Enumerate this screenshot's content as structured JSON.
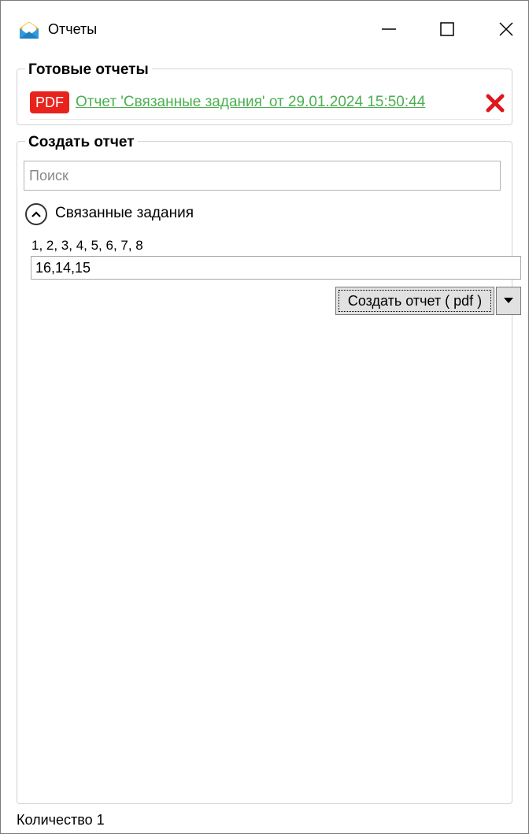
{
  "window": {
    "title": "Отчеты",
    "icons": {
      "app": "envelope-icon",
      "minimize": "minimize-icon",
      "maximize": "maximize-icon",
      "close": "close-icon"
    }
  },
  "ready_reports": {
    "title": "Готовые отчеты",
    "items": [
      {
        "badge": "PDF",
        "link_text": "Отчет 'Связанные задания' от 29.01.2024 15:50:44",
        "delete_icon": "delete-x-icon"
      }
    ]
  },
  "create_report": {
    "title": "Создать отчет",
    "search": {
      "placeholder": "Поиск",
      "value": ""
    },
    "expander": {
      "label": "Связанные задания",
      "icon": "chevron-up-circle-icon"
    },
    "hint": "1, 2, 3, 4, 5, 6, 7, 8",
    "values_input": "16,14,15",
    "create_button": "Создать отчет ( pdf )",
    "dropdown_icon": "caret-down-icon"
  },
  "status": {
    "count_text": "Количество 1"
  },
  "colors": {
    "pdf_badge": "#e8231c",
    "link": "#4caf50",
    "delete": "#e0161d"
  }
}
